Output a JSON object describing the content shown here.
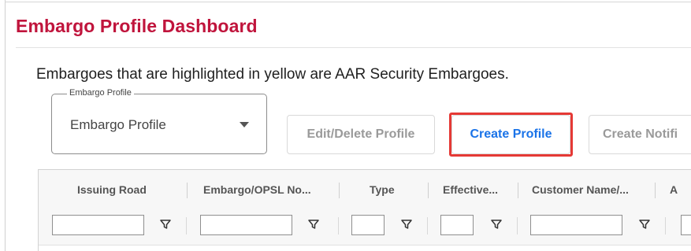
{
  "page": {
    "title": "Embargo Profile Dashboard",
    "info_text": "Embargoes that are highlighted in yellow are AAR Security Embargoes."
  },
  "profile_select": {
    "legend": "Embargo Profile",
    "value": "Embargo Profile"
  },
  "buttons": {
    "edit_delete": "Edit/Delete Profile",
    "create_profile": "Create Profile",
    "create_notification": "Create Notifi"
  },
  "colors": {
    "title": "#c0143c",
    "primary_link": "#1a73e8",
    "highlight": "#e53935"
  },
  "grid": {
    "columns": [
      "Issuing Road",
      "Embargo/OPSL No...",
      "Type",
      "Effective...",
      "Customer Name/...",
      "A"
    ]
  },
  "icons": {
    "filter": "filter-icon",
    "dropdown": "chevron-down-icon"
  }
}
